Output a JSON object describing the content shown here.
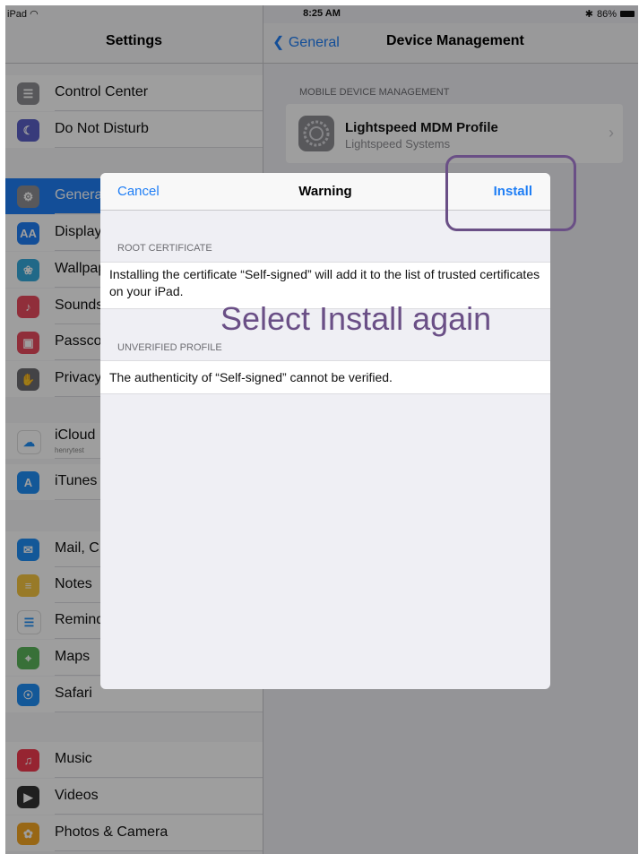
{
  "status_bar": {
    "device": "iPad",
    "time": "8:25 AM",
    "battery": "86%"
  },
  "sidebar": {
    "title": "Settings",
    "items": [
      {
        "label": "Control Center",
        "icon": "control-center-icon",
        "color": "#8e8e93",
        "glyph": "☰"
      },
      {
        "label": "Do Not Disturb",
        "icon": "moon-icon",
        "color": "#5b5fc7",
        "glyph": "☾"
      },
      {
        "label": "General",
        "icon": "gear-icon",
        "color": "#8e8e93",
        "glyph": "⚙"
      },
      {
        "label": "Display",
        "icon": "display-icon",
        "color": "#1f7ef5",
        "glyph": "AA"
      },
      {
        "label": "Wallpaper",
        "icon": "wallpaper-icon",
        "color": "#36aadc",
        "glyph": "❀"
      },
      {
        "label": "Sounds",
        "icon": "sounds-icon",
        "color": "#e94b5e",
        "glyph": "♪"
      },
      {
        "label": "Passcode",
        "icon": "lock-icon",
        "color": "#e94b5e",
        "glyph": "▣"
      },
      {
        "label": "Privacy",
        "icon": "hand-icon",
        "color": "#6d6d72",
        "glyph": "✋"
      },
      {
        "label": "iCloud",
        "sub": "henrytest",
        "icon": "cloud-icon",
        "color": "#ffffff",
        "glyph": "☁"
      },
      {
        "label": "iTunes",
        "icon": "app-store-icon",
        "color": "#1f8ef5",
        "glyph": "A"
      },
      {
        "label": "Mail, C",
        "icon": "mail-icon",
        "color": "#1f8ef5",
        "glyph": "✉"
      },
      {
        "label": "Notes",
        "icon": "notes-icon",
        "color": "#f5c542",
        "glyph": "≡"
      },
      {
        "label": "Reminders",
        "icon": "reminders-icon",
        "color": "#ffffff",
        "glyph": "☰"
      },
      {
        "label": "Maps",
        "icon": "maps-icon",
        "color": "#5bb55b",
        "glyph": "⌖"
      },
      {
        "label": "Safari",
        "icon": "compass-icon",
        "color": "#1f8ef5",
        "glyph": "☉"
      },
      {
        "label": "Music",
        "icon": "music-icon",
        "color": "#f23b4f",
        "glyph": "♫"
      },
      {
        "label": "Videos",
        "icon": "videos-icon",
        "color": "#333333",
        "glyph": "▶"
      },
      {
        "label": "Photos & Camera",
        "icon": "photos-icon",
        "color": "#f5a623",
        "glyph": "✿"
      }
    ]
  },
  "detail": {
    "back_label": "General",
    "title": "Device Management",
    "section_header": "MOBILE DEVICE MANAGEMENT",
    "profile_name": "Lightspeed MDM Profile",
    "profile_org": "Lightspeed Systems"
  },
  "modal": {
    "cancel_label": "Cancel",
    "title": "Warning",
    "install_label": "Install",
    "section1_header": "ROOT CERTIFICATE",
    "section1_text": "Installing the certificate “Self-signed” will add it to the list of trusted certificates on your iPad.",
    "section2_header": "UNVERIFIED PROFILE",
    "section2_text": "The authenticity of “Self-signed” cannot be verified."
  },
  "annotation": {
    "text": "Select Install again",
    "color": "#6a4f86"
  },
  "colors": {
    "accent": "#1f7ef5"
  }
}
